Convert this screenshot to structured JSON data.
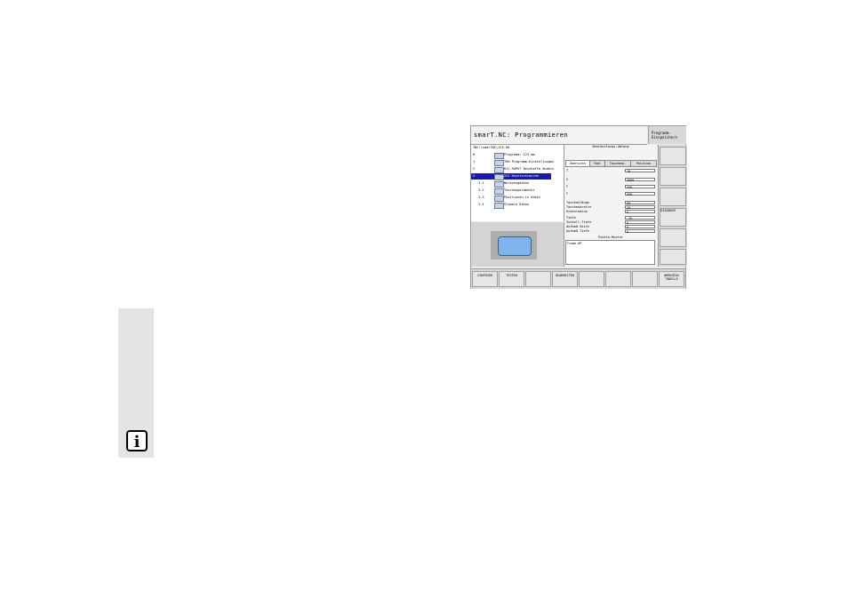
{
  "info_icon": "i",
  "screen": {
    "title": "smarT.NC: Programmieren",
    "mode": "Programm-Einspeichern",
    "path": "TNC:\\smarTNC\\123.HU",
    "tree": [
      {
        "num": "0",
        "label": "Programm: 123 mm"
      },
      {
        "num": "1",
        "label": "700 Programm-Einstellungen"
      },
      {
        "num": "2",
        "label": "611 RÜPKT Beschaffe ändern"
      },
      {
        "num": "3",
        "label": "251 Rechtecktasche"
      },
      {
        "num": "3.1",
        "label": "Werkzeugdaten"
      },
      {
        "num": "3.2",
        "label": "Taschenparameter"
      },
      {
        "num": "3.3",
        "label": "Positionen in Datei"
      },
      {
        "num": "3.4",
        "label": "Globale Daten"
      }
    ],
    "form": {
      "header": "Bearbeitungs-Umfang",
      "tabs": [
        "Übersicht",
        "Tool",
        "Taschenp.",
        "Position"
      ],
      "fields": [
        {
          "label": "T",
          "value": "18"
        },
        {
          "label": "S",
          "value": "3000"
        },
        {
          "label": "F",
          "value": "150"
        },
        {
          "label": "F",
          "value": "500"
        },
        {
          "label": "Taschenlänge",
          "value": "60"
        },
        {
          "label": "Taschenbreite",
          "value": "20"
        },
        {
          "label": "Eckenradius",
          "value": "0"
        },
        {
          "label": "Tiefe",
          "value": "-20"
        },
        {
          "label": "Zustell-Tiefe",
          "value": "5"
        },
        {
          "label": "Aufmaß Seite",
          "value": "0"
        },
        {
          "label": "Aufmaß Tiefe",
          "value": "0"
        }
      ],
      "pattern_title": "Punkte-Muster",
      "pattern_file": "Frame.HP"
    },
    "vsoftkeys": [
      "",
      "",
      "",
      "DIAGNOSE",
      "",
      ""
    ],
    "hsoftkeys": [
      "EINFÜGEN",
      "TESTEN",
      "",
      "BEARBEITEN",
      "",
      "",
      "",
      "WERKZEUG TABELLE"
    ]
  }
}
